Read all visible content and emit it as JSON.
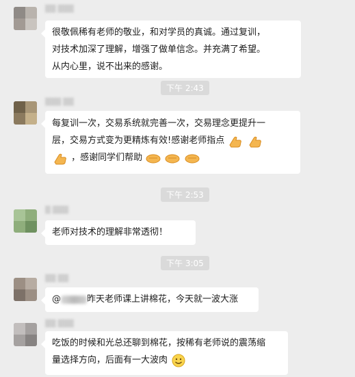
{
  "messages": [
    {
      "lines": [
        "很敬佩稀有老师的敬业，和对学员的真诚。通过复训，",
        "对技术加深了理解，增强了做单信念。并充满了希望。",
        "从内心里，说不出来的感谢。"
      ]
    },
    {
      "time": "下午 2:43",
      "line1": "每复训一次，交易系统就完善一次，交易理念更提升一",
      "line2": "层，交易方式变为更精炼有效!感谢老师指点",
      "line3": "，感谢同学们帮助"
    },
    {
      "time": "下午 2:53",
      "text": "老师对技术的理解非常透彻！"
    },
    {
      "time": "下午 3:05",
      "prefix": "@",
      "text": "昨天老师课上讲棉花，今天就一波大涨"
    },
    {
      "line1": "吃饭的时候和光总还聊到棉花，按稀有老师说的震荡缩",
      "line2": "量选择方向，后面有一大波肉"
    }
  ],
  "icons": {
    "thumb": "thumbs-up-icon",
    "handshake": "handshake-icon",
    "smile": "smile-emoji-icon"
  }
}
